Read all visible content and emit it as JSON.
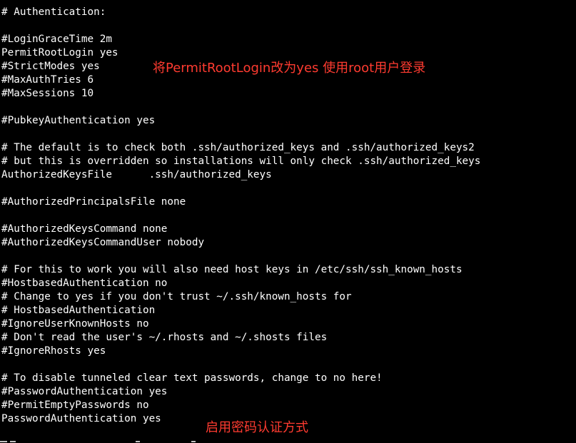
{
  "terminal": {
    "background": "#000000",
    "foreground": "#ffffff",
    "lines": [
      "# Authentication:",
      "",
      "#LoginGraceTime 2m",
      "PermitRootLogin yes",
      "#StrictModes yes",
      "#MaxAuthTries 6",
      "#MaxSessions 10",
      "",
      "#PubkeyAuthentication yes",
      "",
      "# The default is to check both .ssh/authorized_keys and .ssh/authorized_keys2",
      "# but this is overridden so installations will only check .ssh/authorized_keys",
      "AuthorizedKeysFile      .ssh/authorized_keys",
      "",
      "#AuthorizedPrincipalsFile none",
      "",
      "#AuthorizedKeysCommand none",
      "#AuthorizedKeysCommandUser nobody",
      "",
      "# For this to work you will also need host keys in /etc/ssh/ssh_known_hosts",
      "#HostbasedAuthentication no",
      "# Change to yes if you don't trust ~/.ssh/known_hosts for",
      "# HostbasedAuthentication",
      "#IgnoreUserKnownHosts no",
      "# Don't read the user's ~/.rhosts and ~/.shosts files",
      "#IgnoreRhosts yes",
      "",
      "# To disable tunneled clear text passwords, change to no here!",
      "#PasswordAuthentication yes",
      "#PermitEmptyPasswords no",
      "PasswordAuthentication yes"
    ]
  },
  "annotations": {
    "color": "#ff3b30",
    "root_login_note": "将PermitRootLogin改为yes 使用root用户登录",
    "password_auth_note": "启用密码认证方式"
  }
}
